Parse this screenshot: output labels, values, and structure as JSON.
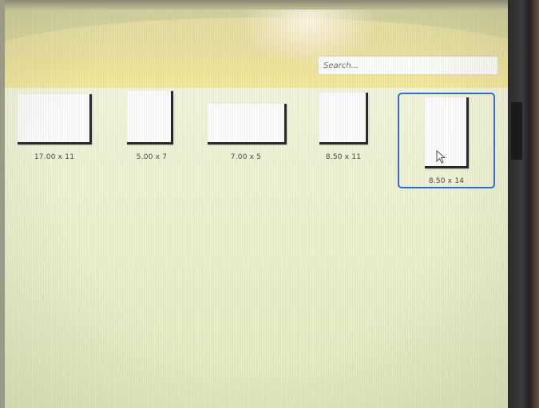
{
  "search": {
    "placeholder": "Search..."
  },
  "paper_sizes": [
    {
      "label": "17.00 x 11",
      "selected": false
    },
    {
      "label": "5.00 x 7",
      "selected": false
    },
    {
      "label": "7.00 x 5",
      "selected": false
    },
    {
      "label": "8.50 x 11",
      "selected": false
    },
    {
      "label": "8.50 x 14",
      "selected": true
    }
  ],
  "colors": {
    "selection_border": "#2f6fd6",
    "header_yellow": "#e6dc8c",
    "content_background": "#eef2d6",
    "paper": "#fbfbfb",
    "paper_edge": "#2a2a2a"
  }
}
